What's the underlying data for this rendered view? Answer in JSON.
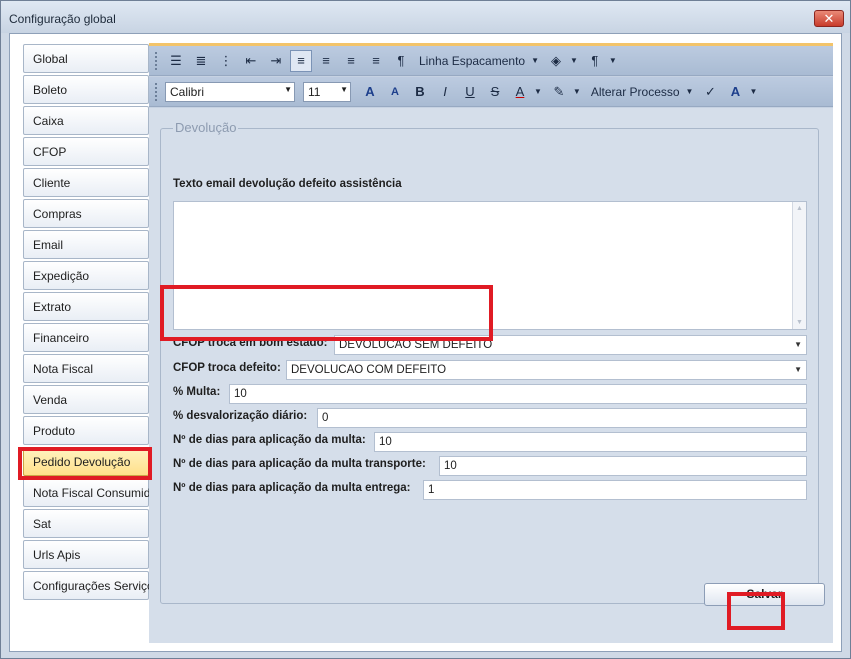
{
  "window": {
    "title": "Configuração global",
    "close_glyph": "✕"
  },
  "sidebar": {
    "items": [
      {
        "label": "Global"
      },
      {
        "label": "Boleto"
      },
      {
        "label": "Caixa"
      },
      {
        "label": "CFOP"
      },
      {
        "label": "Cliente"
      },
      {
        "label": "Compras"
      },
      {
        "label": "Email"
      },
      {
        "label": "Expedição"
      },
      {
        "label": "Extrato"
      },
      {
        "label": "Financeiro"
      },
      {
        "label": "Nota Fiscal"
      },
      {
        "label": "Venda"
      },
      {
        "label": "Produto"
      },
      {
        "label": "Pedido Devolução"
      },
      {
        "label": "Nota Fiscal Consumidor"
      },
      {
        "label": "Sat"
      },
      {
        "label": "Urls Apis"
      },
      {
        "label": "Configurações Serviços"
      }
    ],
    "active": "Pedido Devolução"
  },
  "toolbar": {
    "line_spacing": "Linha Espacamento",
    "font_name": "Calibri",
    "font_size": "11",
    "alter_process": "Alterar Processo"
  },
  "form": {
    "group_title": "Devolução",
    "email_label": "Texto email devolução defeito assistência",
    "email_value": "",
    "cfop_bom_label": "CFOP troca em bom estado:",
    "cfop_bom_value": "DEVOLUCAO SEM DEFEITO",
    "cfop_defeito_label": "CFOP troca defeito:",
    "cfop_defeito_value": "DEVOLUCAO COM DEFEITO",
    "multa_label": "% Multa:",
    "multa_value": "10",
    "desval_label": "% desvalorização diário:",
    "desval_value": "0",
    "dias_multa_label": "Nº de dias para aplicação da multa:",
    "dias_multa_value": "10",
    "dias_transp_label": "Nº de dias para aplicação da multa transporte:",
    "dias_transp_value": "10",
    "dias_entrega_label": "Nº de dias para aplicação da multa entrega:",
    "dias_entrega_value": "1"
  },
  "actions": {
    "save_label": "Salvar"
  },
  "colors": {
    "highlight": "#e01b24",
    "accent": "#f3c46a",
    "active_tab": "#ffe08a"
  }
}
